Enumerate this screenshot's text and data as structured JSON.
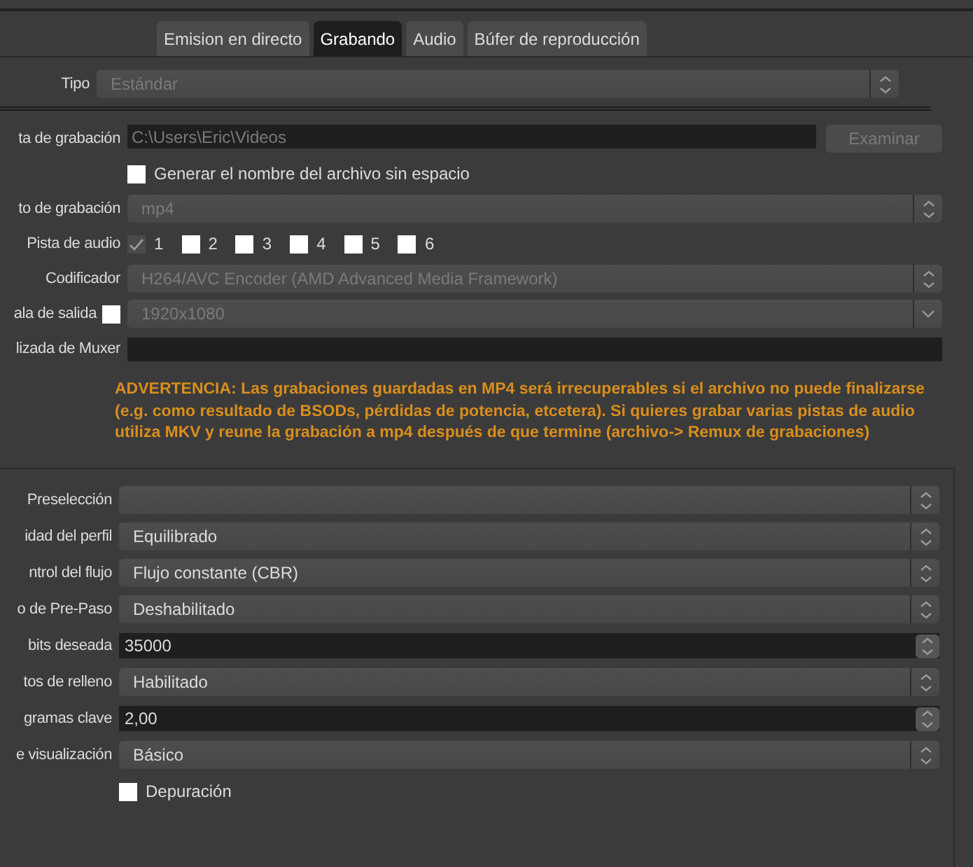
{
  "tabs": [
    {
      "label": "Emision en directo",
      "selected": false
    },
    {
      "label": "Grabando",
      "selected": true
    },
    {
      "label": "Audio",
      "selected": false
    },
    {
      "label": "Búfer de reproducción",
      "selected": false
    }
  ],
  "type_row": {
    "label": "Tipo",
    "value": "Estándar",
    "disabled": true
  },
  "recording": {
    "rows": [
      {
        "kind": "path",
        "label": "ta de grabación",
        "value": "C:\\Users\\Eric\\Videos",
        "button": "Examinar",
        "disabled": true
      },
      {
        "kind": "checkbox",
        "text": "Generar el nombre del archivo sin espacio",
        "checked": false
      },
      {
        "kind": "combo",
        "label": "to de grabación",
        "value": "mp4",
        "disabled": true
      },
      {
        "kind": "tracks",
        "label": "Pista de audio",
        "tracks": [
          {
            "label": "1",
            "checked": true
          },
          {
            "label": "2",
            "checked": false
          },
          {
            "label": "3",
            "checked": false
          },
          {
            "label": "4",
            "checked": false
          },
          {
            "label": "5",
            "checked": false
          },
          {
            "label": "6",
            "checked": false
          }
        ]
      },
      {
        "kind": "combo",
        "label": "Codificador",
        "value": "H264/AVC Encoder (AMD Advanced Media Framework)",
        "disabled": true
      },
      {
        "kind": "rescale",
        "label": "ala de salida",
        "checked": false,
        "value": "1920x1080",
        "disabled": true
      },
      {
        "kind": "text",
        "label": "lizada de Muxer"
      }
    ]
  },
  "warning": "ADVERTENCIA: Las grabaciones guardadas en MP4 será irrecuperables si el archivo no puede finalizarse (e.g. como resultado de BSODs, pérdidas de potencia, etcetera). Si quieres grabar varias pistas de audio utiliza MKV y reune la grabación a mp4 después de que termine (archivo-> Remux de grabaciones)",
  "encoder": {
    "rows": [
      {
        "kind": "combo",
        "label": "Preselección"
      },
      {
        "kind": "combo",
        "label": "idad del perfil",
        "value": "Equilibrado"
      },
      {
        "kind": "combo",
        "label": "ntrol del flujo",
        "value": "Flujo constante (CBR)"
      },
      {
        "kind": "combo",
        "label": "o de Pre-Paso",
        "value": "Deshabilitado"
      },
      {
        "kind": "spin",
        "label": "bits deseada",
        "value": "35000"
      },
      {
        "kind": "combo",
        "label": "tos de relleno",
        "value": "Habilitado"
      },
      {
        "kind": "spin",
        "label": "gramas clave",
        "value": "2,00"
      },
      {
        "kind": "combo",
        "label": "e visualización",
        "value": "Básico"
      },
      {
        "kind": "checkbox",
        "text": "Depuración",
        "checked": false
      }
    ]
  }
}
